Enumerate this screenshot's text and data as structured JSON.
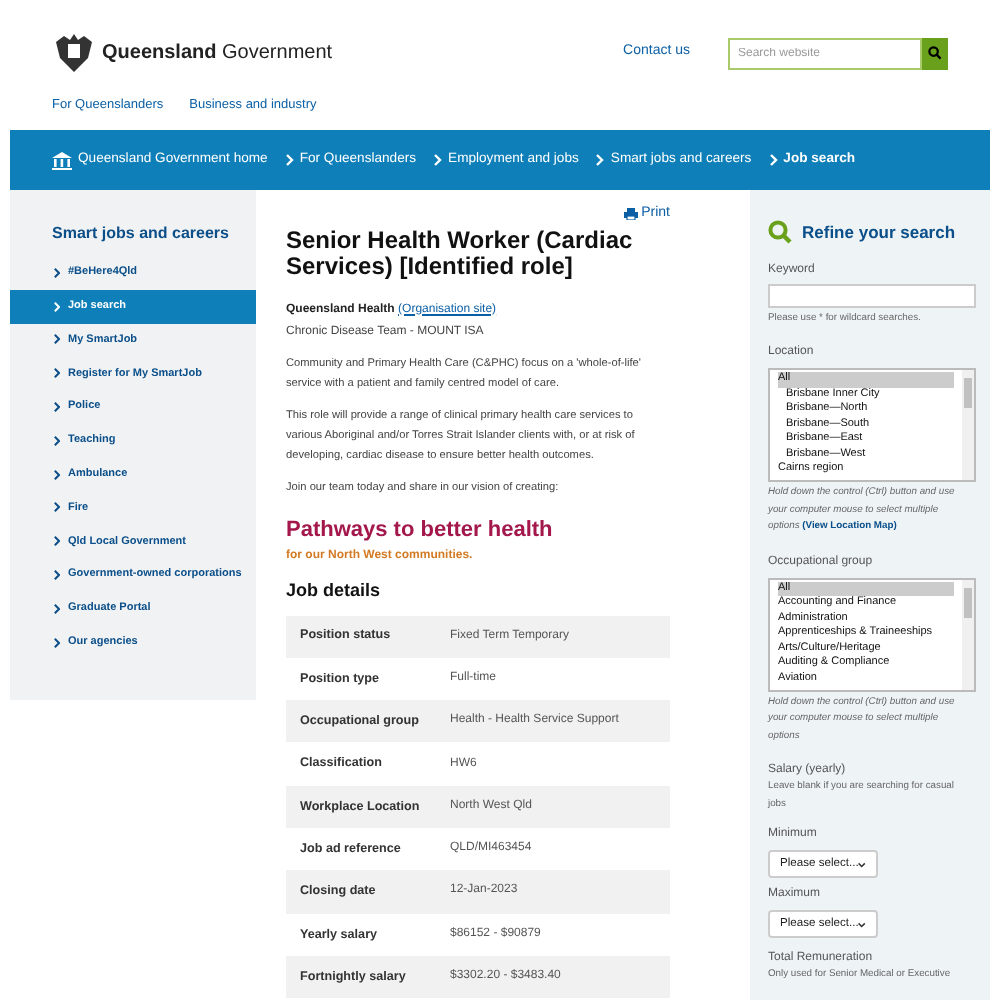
{
  "header": {
    "logo_text_bold": "Queensland",
    "logo_text": "Government",
    "contact": "Contact us",
    "search_placeholder": "Search website"
  },
  "top_links": [
    "For Queenslanders",
    "Business and industry"
  ],
  "breadcrumbs": [
    {
      "label": "Queensland Government home",
      "current": false
    },
    {
      "label": "For Queenslanders",
      "current": false
    },
    {
      "label": "Employment and jobs",
      "current": false
    },
    {
      "label": "Smart jobs and careers",
      "current": false
    },
    {
      "label": "Job search",
      "current": true
    }
  ],
  "sidebar": {
    "title": "Smart jobs and careers",
    "items": [
      {
        "label": "#BeHere4Qld",
        "selected": false
      },
      {
        "label": "Job search",
        "selected": true
      },
      {
        "label": "My SmartJob",
        "selected": false
      },
      {
        "label": "Register for My SmartJob",
        "selected": false
      },
      {
        "label": "Police",
        "selected": false
      },
      {
        "label": "Teaching",
        "selected": false
      },
      {
        "label": "Ambulance",
        "selected": false
      },
      {
        "label": "Fire",
        "selected": false
      },
      {
        "label": "Qld Local Government",
        "selected": false
      },
      {
        "label": "Government-owned corporations",
        "selected": false
      },
      {
        "label": "Graduate Portal",
        "selected": false
      },
      {
        "label": "Our agencies",
        "selected": false
      }
    ]
  },
  "job": {
    "print": "Print",
    "title": "Senior Health Worker (Cardiac Services) [Identified role]",
    "agency": "Queensland Health",
    "agency_link": "(Organisation site)",
    "team": "Chronic Disease Team - MOUNT ISA",
    "paragraphs": [
      "Community and Primary Health Care (C&PHC) focus on a 'whole-of-life' service with a patient and family centred model of care.",
      "This role will provide a range of clinical primary health care services to various Aboriginal and/or Torres Strait Islander clients with, or at risk of developing, cardiac disease to ensure better health outcomes.",
      "Join our team today and share in our vision of creating:"
    ],
    "tagline": "Pathways to better health",
    "tagline_sub": "for our North West communities.",
    "details_heading": "Job details",
    "details": [
      {
        "label": "Position status",
        "value": "Fixed Term Temporary"
      },
      {
        "label": "Position type",
        "value": "Full-time"
      },
      {
        "label": "Occupational group",
        "value": "Health - Health Service Support"
      },
      {
        "label": "Classification",
        "value": "HW6"
      },
      {
        "label": "Workplace Location",
        "value": "North West Qld"
      },
      {
        "label": "Job ad reference",
        "value": "QLD/MI463454"
      },
      {
        "label": "Closing date",
        "value": "12-Jan-2023"
      },
      {
        "label": "Yearly salary",
        "value": "$86152 - $90879"
      },
      {
        "label": "Fortnightly salary",
        "value": "$3302.20 - $3483.40"
      }
    ]
  },
  "refine": {
    "title": "Refine your search",
    "keyword_label": "Keyword",
    "keyword_hint": "Please use * for wildcard searches.",
    "location_label": "Location",
    "location_options": [
      {
        "label": "All",
        "selected": true,
        "kind": "top"
      },
      {
        "label": "Brisbane Inner City",
        "selected": false,
        "kind": "sub"
      },
      {
        "label": "Brisbane—North",
        "selected": false,
        "kind": "sub"
      },
      {
        "label": "Brisbane—South",
        "selected": false,
        "kind": "sub"
      },
      {
        "label": "Brisbane—East",
        "selected": false,
        "kind": "sub"
      },
      {
        "label": "Brisbane—West",
        "selected": false,
        "kind": "sub"
      },
      {
        "label": "Cairns region",
        "selected": false,
        "kind": "top"
      }
    ],
    "location_hint": "Hold down the control (Ctrl) button and use your computer mouse to select multiple options",
    "location_link": "(View Location Map)",
    "group_label": "Occupational group",
    "group_options": [
      {
        "label": "All",
        "selected": true
      },
      {
        "label": "Accounting and Finance",
        "selected": false
      },
      {
        "label": "Administration",
        "selected": false
      },
      {
        "label": "Apprenticeships & Traineeships",
        "selected": false
      },
      {
        "label": "Arts/Culture/Heritage",
        "selected": false
      },
      {
        "label": "Auditing & Compliance",
        "selected": false
      },
      {
        "label": "Aviation",
        "selected": false
      }
    ],
    "group_hint": "Hold down the control (Ctrl) button and use your computer mouse to select multiple options",
    "salary_label": "Salary (yearly)",
    "salary_hint": "Leave blank if you are searching for casual jobs",
    "minimum_label": "Minimum",
    "minimum_value": "Please select...",
    "maximum_label": "Maximum",
    "maximum_value": "Please select...",
    "total_label": "Total Remuneration",
    "total_hint": "Only used for Senior Medical or Executive"
  }
}
